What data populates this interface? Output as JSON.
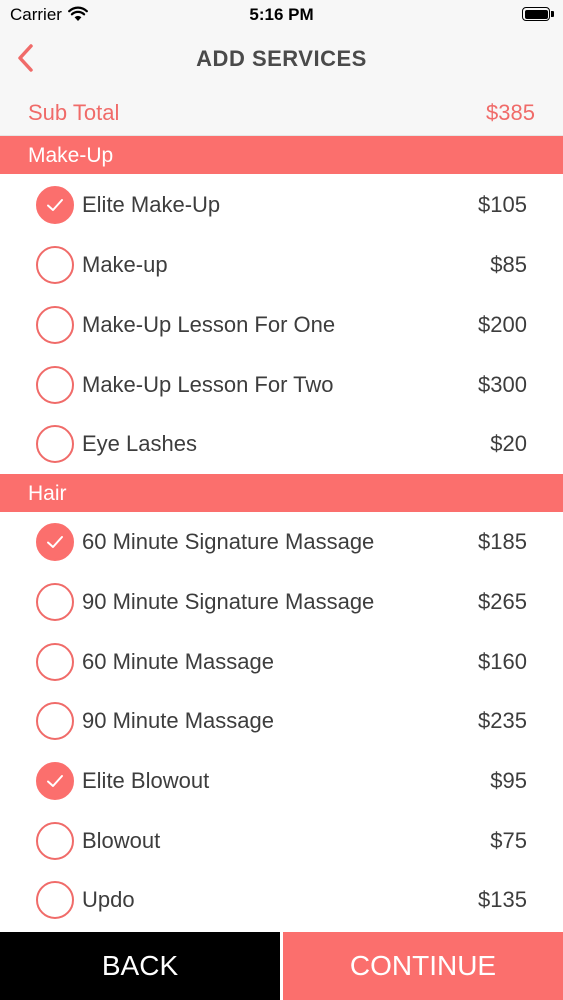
{
  "status_bar": {
    "carrier": "Carrier",
    "time": "5:16 PM"
  },
  "nav": {
    "title": "ADD SERVICES"
  },
  "subtotal": {
    "label": "Sub Total",
    "value": "$385"
  },
  "sections": [
    {
      "title": "Make-Up",
      "items": [
        {
          "label": "Elite Make-Up",
          "price": "$105",
          "selected": true
        },
        {
          "label": "Make-up",
          "price": "$85",
          "selected": false
        },
        {
          "label": "Make-Up Lesson For One",
          "price": "$200",
          "selected": false
        },
        {
          "label": "Make-Up Lesson For Two",
          "price": "$300",
          "selected": false
        },
        {
          "label": "Eye Lashes",
          "price": "$20",
          "selected": false
        }
      ]
    },
    {
      "title": "Hair",
      "items": [
        {
          "label": "60 Minute Signature Massage",
          "price": "$185",
          "selected": true
        },
        {
          "label": "90 Minute Signature Massage",
          "price": "$265",
          "selected": false
        },
        {
          "label": "60 Minute Massage",
          "price": "$160",
          "selected": false
        },
        {
          "label": "90 Minute Massage",
          "price": "$235",
          "selected": false
        },
        {
          "label": "Elite Blowout",
          "price": "$95",
          "selected": true
        },
        {
          "label": "Blowout",
          "price": "$75",
          "selected": false
        },
        {
          "label": "Updo",
          "price": "$135",
          "selected": false
        }
      ]
    }
  ],
  "footer": {
    "back_label": "BACK",
    "continue_label": "CONTINUE"
  },
  "colors": {
    "accent": "#fb6f6d",
    "accent_text": "#f06b69",
    "text": "#3d3d3d",
    "title": "#4a4a4a"
  }
}
